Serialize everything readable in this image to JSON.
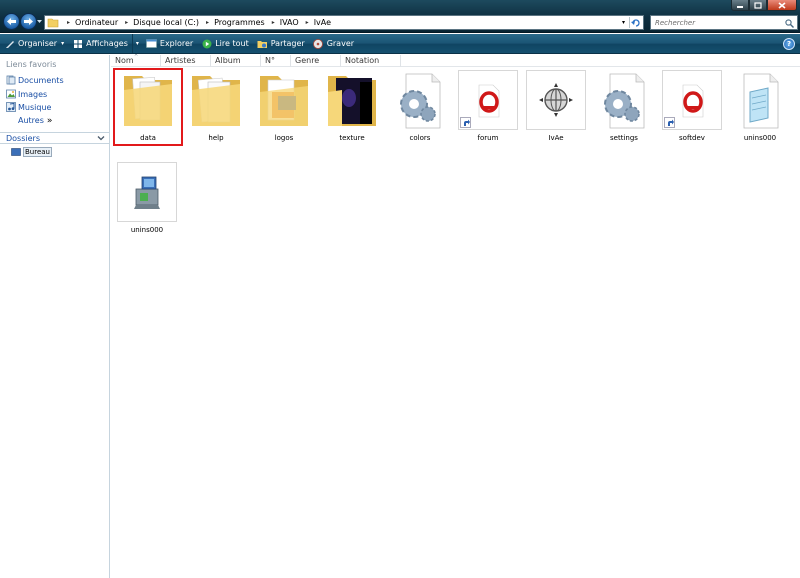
{
  "window": {
    "minimize_glyph": "─",
    "maximize_glyph": "□",
    "close_glyph": "✕"
  },
  "address_bar": {
    "breadcrumbs": [
      "Ordinateur",
      "Disque local (C:)",
      "Programmes",
      "IVAO",
      "IvAe"
    ],
    "separator": "▸",
    "dropdown_glyph": "▾"
  },
  "search": {
    "placeholder": "Rechercher"
  },
  "command_bar": {
    "organiser": "Organiser",
    "affichages": "Affichages",
    "explorer": "Explorer",
    "lire_tout": "Lire tout",
    "partager": "Partager",
    "graver": "Graver",
    "caret": "▾",
    "help": "?"
  },
  "nav_pane": {
    "favorites_title": "Liens favoris",
    "favorites": [
      "Documents",
      "Images",
      "Musique"
    ],
    "more_label": "Autres",
    "more_glyph": "»",
    "folders_title": "Dossiers",
    "tree": [
      "Bureau"
    ]
  },
  "columns": [
    "Nom",
    "Artistes",
    "Album",
    "N°",
    "Genre",
    "Notation"
  ],
  "sort_glyph": "^",
  "files": [
    {
      "name": "data",
      "icon": "folder-icon",
      "selected": true
    },
    {
      "name": "help",
      "icon": "folder-icon"
    },
    {
      "name": "logos",
      "icon": "folder-icon"
    },
    {
      "name": "texture",
      "icon": "folder-icon"
    },
    {
      "name": "colors",
      "icon": "config-file-icon"
    },
    {
      "name": "forum",
      "icon": "opera-shortcut-icon"
    },
    {
      "name": "IvAe",
      "icon": "globe-app-icon"
    },
    {
      "name": "settings",
      "icon": "config-file-icon"
    },
    {
      "name": "softdev",
      "icon": "opera-shortcut-icon"
    },
    {
      "name": "unins000",
      "icon": "notepad-file-icon"
    },
    {
      "name": "unins000",
      "icon": "installer-icon"
    }
  ],
  "colors": {
    "selection_outline": "#e2191b",
    "link_blue": "#1a4fa5"
  }
}
